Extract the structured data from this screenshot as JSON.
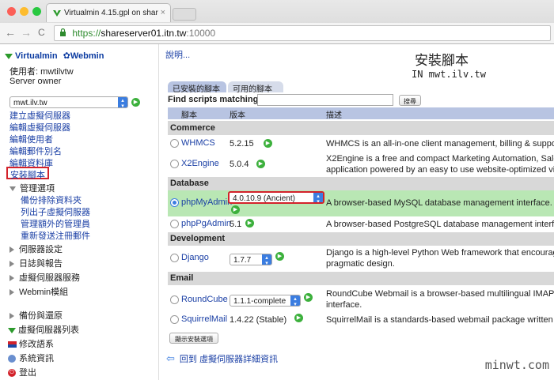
{
  "browser": {
    "tab_title": "Virtualmin 4.15.gpl on shar",
    "tab_close": "×",
    "url_scheme": "https://",
    "url_host": "shareserver01.itn.tw",
    "url_port": ":10000",
    "back": "←",
    "forward": "→",
    "reload": "C"
  },
  "sidebar": {
    "brand_virtualmin": "Virtualmin",
    "brand_webmin": "Webmin",
    "user_line": "使用者: mwtilvtw",
    "role_line": "Server owner",
    "domain_select": "mwt.ilv.tw",
    "links": [
      "建立虛擬伺服器",
      "編輯虛擬伺服器",
      "編輯使用者",
      "編輯郵件別名",
      "編輯資料庫",
      "安裝腳本"
    ],
    "manage_label": "管理選項",
    "manage_links": [
      "備份排除資料夾",
      "列出子虛擬伺服器",
      "管理額外的管理員",
      "重新發送注冊郵件"
    ],
    "sections": [
      "伺服器設定",
      "日誌與報告",
      "虛擬伺服器服務",
      "Webmin模組"
    ],
    "bottom_links": [
      "備份與還原",
      "虛擬伺服器列表",
      "修改語系",
      "系統資訊",
      "登出"
    ]
  },
  "main": {
    "help_link": "說明...",
    "title": "安裝腳本",
    "subtitle": "IN mwt.ilv.tw",
    "tabs": [
      "已安裝的腳本",
      "可用的腳本"
    ],
    "find_label": "Find scripts matching:",
    "search_button": "搜尋",
    "columns": [
      "腳本",
      "版本",
      "描述"
    ],
    "categories": {
      "commerce": "Commerce",
      "database": "Database",
      "development": "Development",
      "email": "Email"
    },
    "scripts": {
      "whmcs": {
        "name": "WHMCS",
        "version": "5.2.15",
        "desc": [
          "WHMCS is an all-in-one client management, billing & support so"
        ]
      },
      "x2engine": {
        "name": "X2Engine",
        "version": "5.0.4",
        "desc": [
          "X2Engine is a free and compact Marketing Automation, Sales F",
          "application powered by an easy to use website-optimized visual"
        ]
      },
      "phpmyadmin": {
        "name": "phpMyAdmin",
        "version": "4.0.10.9 (Ancient)",
        "desc": [
          "A browser-based MySQL database management interface."
        ]
      },
      "phppgadmin": {
        "name": "phpPgAdmin",
        "version": "5.1",
        "desc": [
          "A browser-based PostgreSQL database management interface"
        ]
      },
      "django": {
        "name": "Django",
        "version": "1.7.7",
        "desc": [
          "Django is a high-level Python Web framework that encourages",
          "pragmatic design."
        ]
      },
      "roundcube": {
        "name": "RoundCube",
        "version": "1.1.1-complete",
        "desc": [
          "RoundCube Webmail is a browser-based multilingual IMAP clien",
          "interface."
        ]
      },
      "squirrelmail": {
        "name": "SquirrelMail",
        "version": "1.4.22 (Stable)",
        "desc": [
          "SquirrelMail is a standards-based webmail package written in P"
        ]
      }
    },
    "show_install_button": "顯示安裝選項",
    "back_link": "回到 虛擬伺服器詳細資訊",
    "back_arrow": "⇦"
  },
  "watermark": "minwt.com",
  "colors": {
    "accent": "#3b7de0",
    "selected_row": "#b9e7b4",
    "highlight_box": "#d3222a"
  }
}
